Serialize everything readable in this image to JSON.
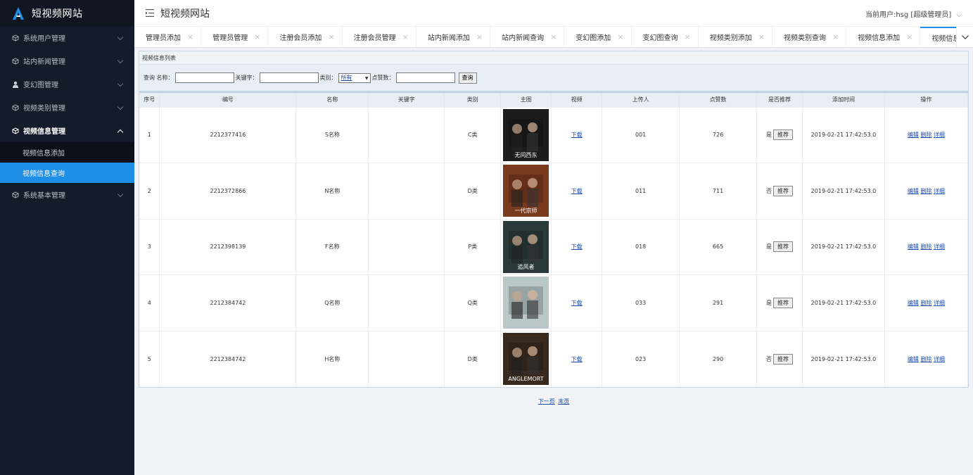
{
  "app": {
    "title": "短视频网站"
  },
  "header": {
    "user_info": "当前用户:hsg [超级管理员]"
  },
  "sidebar": {
    "items": [
      {
        "label": "系统用户管理",
        "icon": "cube-icon"
      },
      {
        "label": "站内新闻管理",
        "icon": "cube-icon"
      },
      {
        "label": "变幻图管理",
        "icon": "user-icon"
      },
      {
        "label": "视频类别管理",
        "icon": "cube-icon"
      },
      {
        "label": "视频信息管理",
        "icon": "cube-icon"
      },
      {
        "label": "系统基本管理",
        "icon": "cube-icon"
      }
    ],
    "sub_items": [
      {
        "label": "视频信息添加"
      },
      {
        "label": "视频信息查询"
      }
    ]
  },
  "tabs": [
    {
      "label": "管理员添加"
    },
    {
      "label": "管理员管理"
    },
    {
      "label": "注册会员添加"
    },
    {
      "label": "注册会员管理"
    },
    {
      "label": "站内新闻添加"
    },
    {
      "label": "站内新闻查询"
    },
    {
      "label": "变幻图添加"
    },
    {
      "label": "变幻图查询"
    },
    {
      "label": "视频类别添加"
    },
    {
      "label": "视频类别查询"
    },
    {
      "label": "视频信息添加"
    },
    {
      "label": "视频信息查"
    }
  ],
  "panel": {
    "title": "视频信息列表"
  },
  "search": {
    "query_label": "查询 名称：",
    "keyword_label": "关键字：",
    "category_label": "类别：",
    "category_value": "所有",
    "likes_label": "点赞数：",
    "button": "查询",
    "name_value": "",
    "keyword_value": "",
    "likes_value": ""
  },
  "table": {
    "headers": [
      "序号",
      "编号",
      "名称",
      "关键字",
      "类别",
      "主图",
      "视频",
      "上传人",
      "点赞数",
      "是否推荐",
      "添加时间",
      "操作"
    ],
    "rows": [
      {
        "seq": "1",
        "code": "2212377416",
        "name": "S名称",
        "keyword": "",
        "category": "C类",
        "video": "下载",
        "uploader": "001",
        "likes": "726",
        "recommended": "是",
        "rec_btn": "推荐",
        "time": "2019-02-21 17:42:53.0",
        "poster_text": "无问西东",
        "poster_color": "#1c1c1c"
      },
      {
        "seq": "2",
        "code": "2212372866",
        "name": "N名称",
        "keyword": "",
        "category": "D类",
        "video": "下载",
        "uploader": "011",
        "likes": "711",
        "recommended": "否",
        "rec_btn": "推荐",
        "time": "2019-02-21 17:42:53.0",
        "poster_text": "一代宗师",
        "poster_color": "#7a3a1e"
      },
      {
        "seq": "3",
        "code": "2212398139",
        "name": "F名称",
        "keyword": "",
        "category": "P类",
        "video": "下载",
        "uploader": "018",
        "likes": "665",
        "recommended": "是",
        "rec_btn": "推荐",
        "time": "2019-02-21 17:42:53.0",
        "poster_text": "追风者",
        "poster_color": "#2a3a3a"
      },
      {
        "seq": "4",
        "code": "2212384742",
        "name": "Q名称",
        "keyword": "",
        "category": "Q类",
        "video": "下载",
        "uploader": "033",
        "likes": "291",
        "recommended": "是",
        "rec_btn": "推荐",
        "time": "2019-02-21 17:42:53.0",
        "poster_text": "",
        "poster_color": "#b9c7c9"
      },
      {
        "seq": "5",
        "code": "2212384742",
        "name": "H名称",
        "keyword": "",
        "category": "D类",
        "video": "下载",
        "uploader": "023",
        "likes": "290",
        "recommended": "否",
        "rec_btn": "推荐",
        "time": "2019-02-21 17:42:53.0",
        "poster_text": "ANGLEMORT",
        "poster_color": "#3a2a1e"
      }
    ],
    "actions": {
      "edit": "编辑",
      "delete": "删除",
      "detail": "详细"
    }
  },
  "pager": {
    "next": "下一页",
    "last": "末页"
  },
  "colors": {
    "sidebar_bg": "#141c2b",
    "accent": "#1e8fe8",
    "link": "#1a4da8"
  }
}
